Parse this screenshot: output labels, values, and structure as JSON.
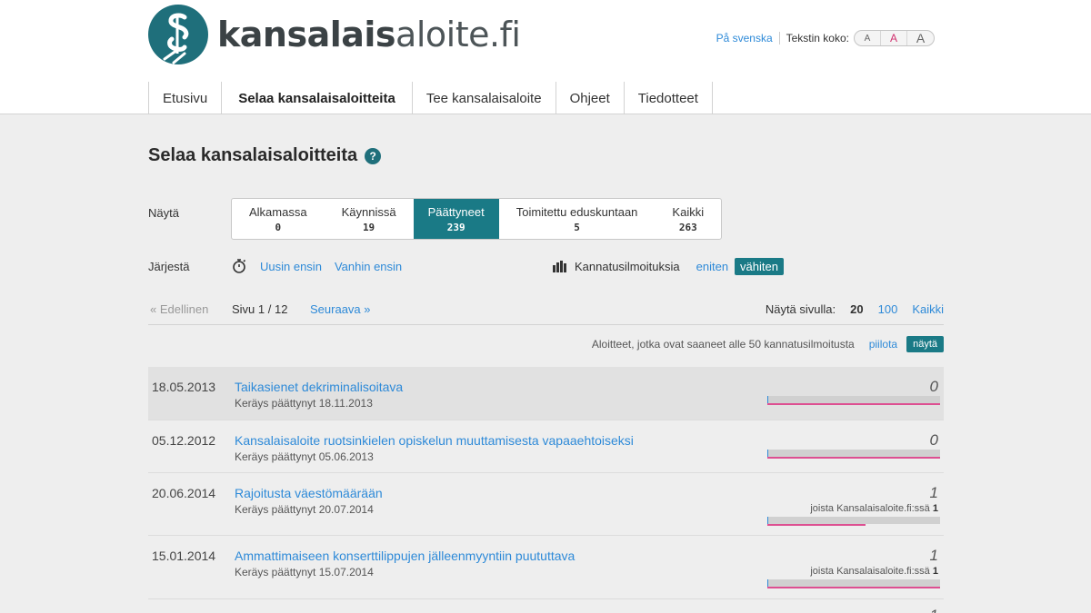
{
  "logo": {
    "bold": "kansalais",
    "light": "aloite.fi"
  },
  "util": {
    "language_link": "På svenska",
    "text_size_label": "Tekstin koko:",
    "sizes": [
      "A",
      "A",
      "A"
    ]
  },
  "nav": [
    {
      "label": "Etusivu"
    },
    {
      "label": "Selaa kansalaisaloitteita",
      "active": true
    },
    {
      "label": "Tee kansalaisaloite"
    },
    {
      "label": "Ohjeet"
    },
    {
      "label": "Tiedotteet"
    }
  ],
  "page_title": "Selaa kansalaisaloitteita",
  "help_icon_glyph": "?",
  "show_label": "Näytä",
  "filters": [
    {
      "label": "Alkamassa",
      "count": "0"
    },
    {
      "label": "Käynnissä",
      "count": "19"
    },
    {
      "label": "Päättyneet",
      "count": "239",
      "active": true
    },
    {
      "label": "Toimitettu eduskuntaan",
      "count": "5"
    },
    {
      "label": "Kaikki",
      "count": "263"
    }
  ],
  "sort": {
    "label": "Järjestä",
    "newest": "Uusin ensin",
    "oldest": "Vanhin ensin",
    "support_label": "Kannatusilmoituksia",
    "most": "eniten",
    "least": "vähiten"
  },
  "pager": {
    "prev": "« Edellinen",
    "page": "Sivu 1 / 12",
    "next": "Seuraava »",
    "per_page_label": "Näytä sivulla:",
    "per_page_current": "20",
    "per_page_100": "100",
    "per_page_all": "Kaikki"
  },
  "low_support": {
    "text": "Aloitteet, jotka ovat saaneet alle 50 kannatusilmoitusta",
    "hide": "piilota",
    "show": "näytä"
  },
  "initiatives": [
    {
      "date": "18.05.2013",
      "title": "Taikasienet dekriminalisoitava",
      "sub": "Keräys päättynyt 18.11.2013",
      "count": "0",
      "joista": "",
      "joista_count": "",
      "progress": 0
    },
    {
      "date": "05.12.2012",
      "title": "Kansalaisaloite ruotsinkielen opiskelun muuttamisesta vapaaehtoiseksi",
      "sub": "Keräys päättynyt 05.06.2013",
      "count": "0",
      "joista": "",
      "joista_count": "",
      "progress": 0
    },
    {
      "date": "20.06.2014",
      "title": "Rajoitusta väestömäärään",
      "sub": "Keräys päättynyt 20.07.2014",
      "count": "1",
      "joista": "joista Kansalaisaloite.fi:ssä",
      "joista_count": "1",
      "progress": 0.57
    },
    {
      "date": "15.01.2014",
      "title": "Ammattimaiseen konserttilippujen jälleenmyyntiin puututtava",
      "sub": "Keräys päättynyt 15.07.2014",
      "count": "1",
      "joista": "joista Kansalaisaloite.fi:ssä",
      "joista_count": "1",
      "progress": 1.0
    }
  ]
}
